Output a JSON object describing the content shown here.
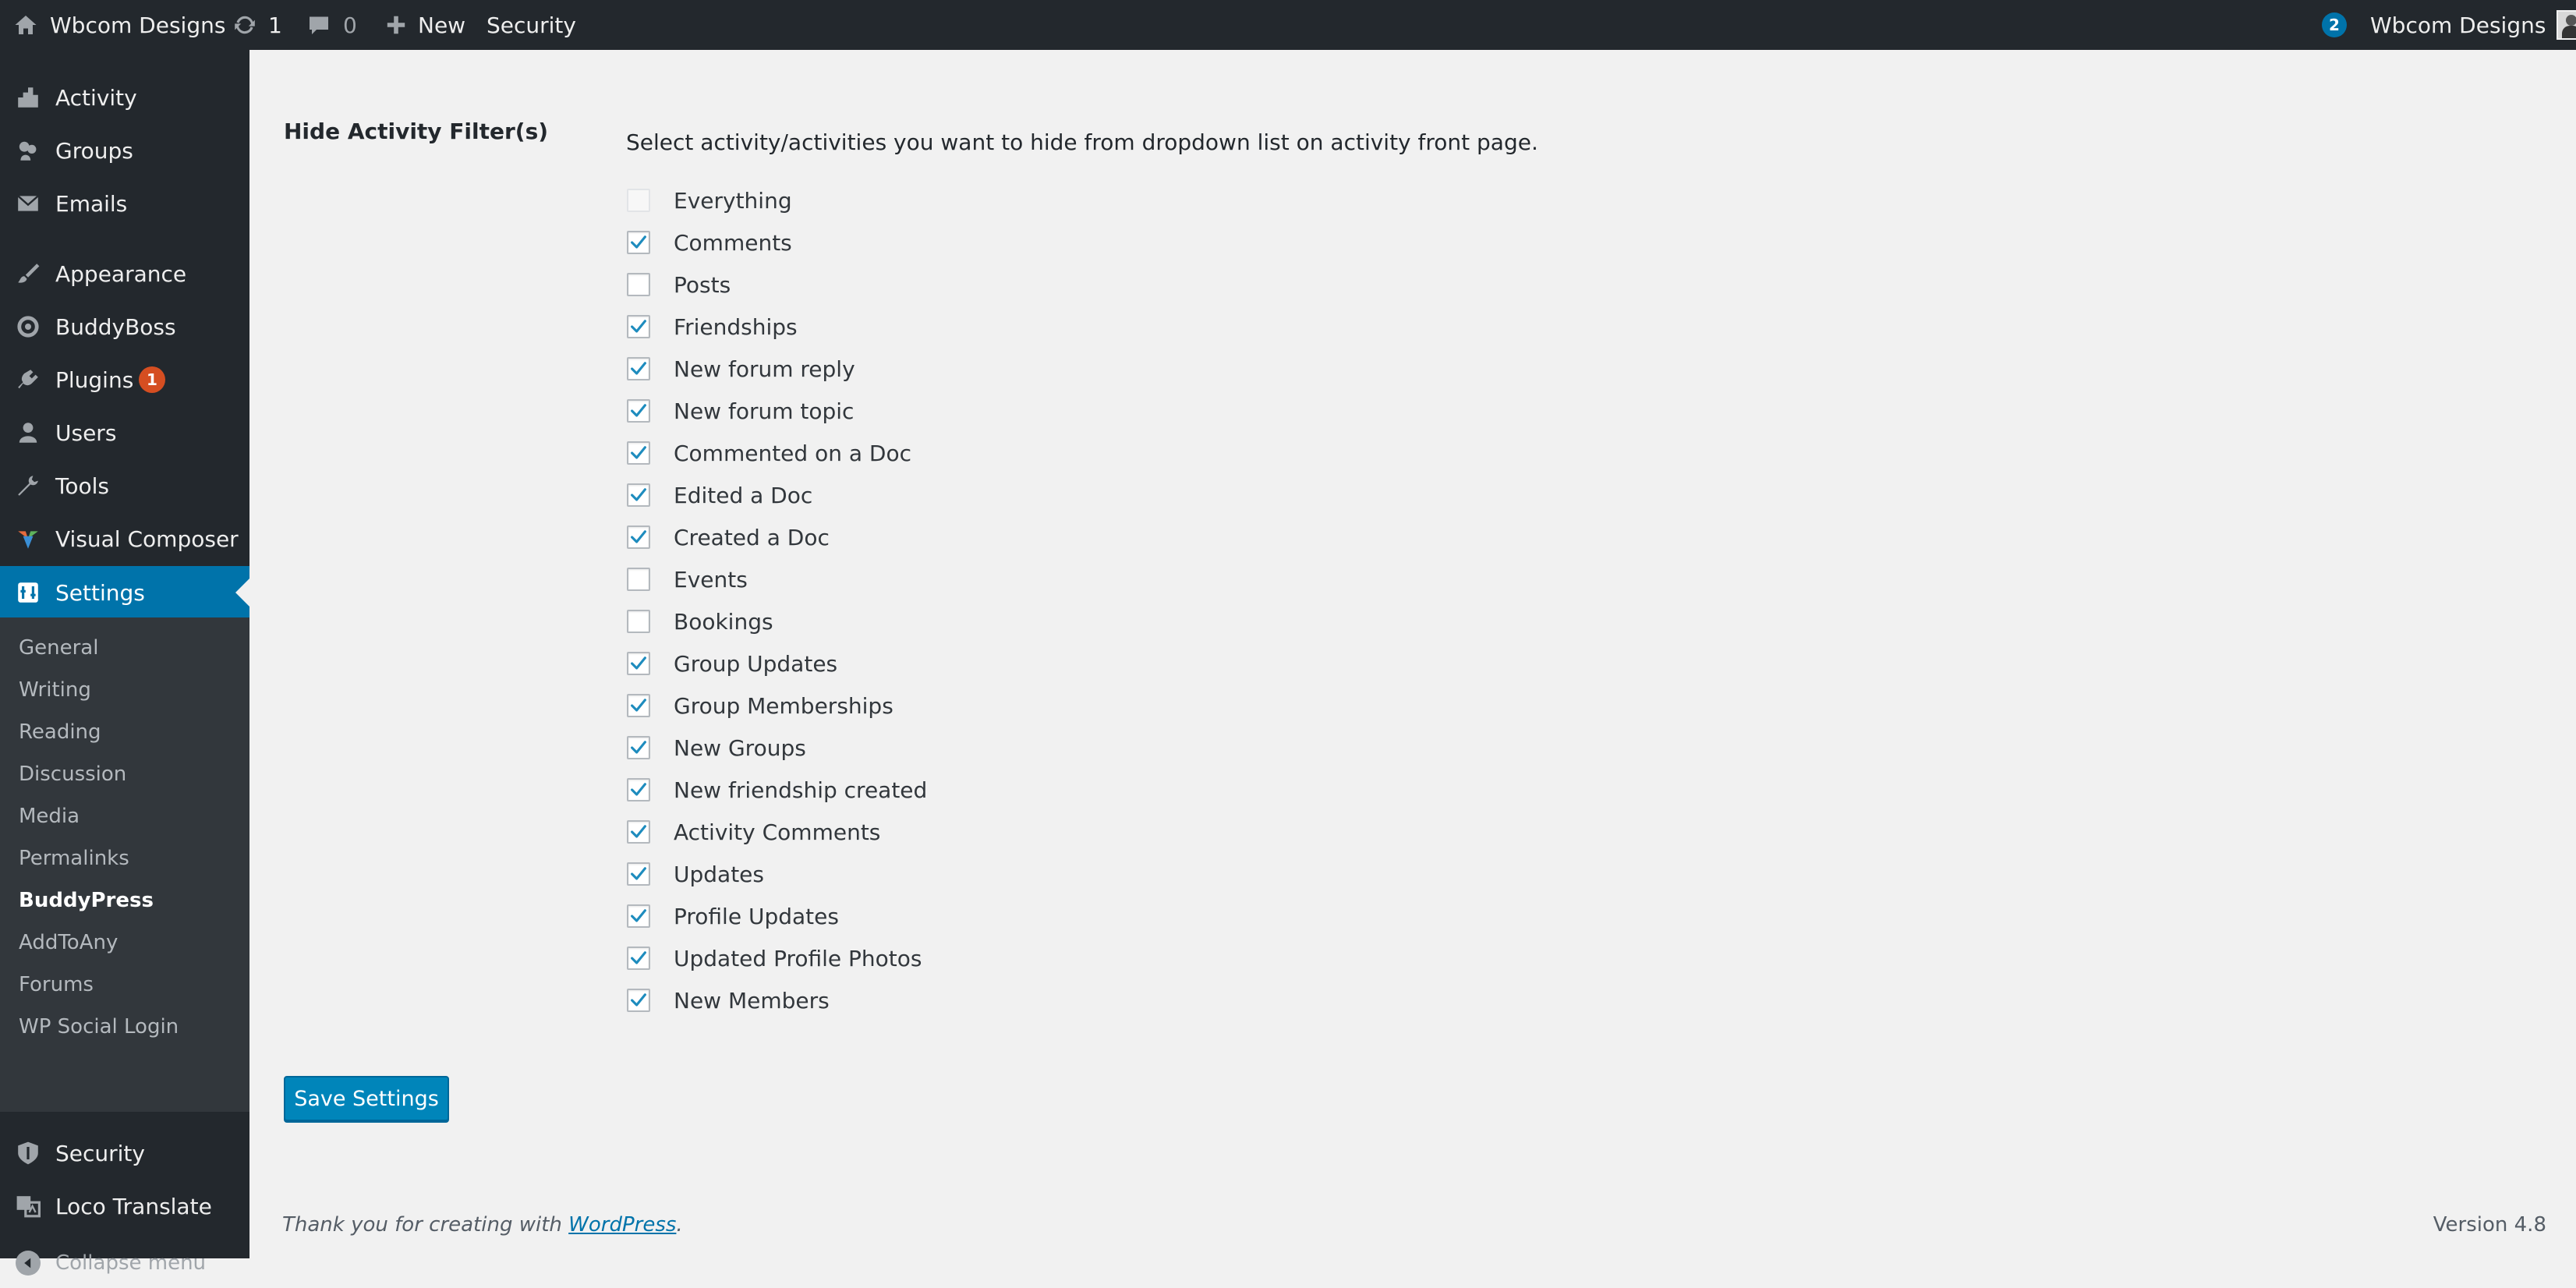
{
  "admin_bar": {
    "site_name": "Wbcom Designs",
    "updates_count": "1",
    "comments_count": "0",
    "new_label": "New",
    "security_label": "Security",
    "notifications_count": "2",
    "account_name": "Wbcom Designs"
  },
  "sidebar": {
    "items": [
      {
        "label": "Activity",
        "icon": "activity-icon"
      },
      {
        "label": "Groups",
        "icon": "groups-icon"
      },
      {
        "label": "Emails",
        "icon": "email-icon"
      },
      {
        "label": "Appearance",
        "icon": "paintbrush-icon"
      },
      {
        "label": "BuddyBoss",
        "icon": "buddyboss-icon"
      },
      {
        "label": "Plugins",
        "icon": "plugin-icon",
        "badge": "1"
      },
      {
        "label": "Users",
        "icon": "users-icon"
      },
      {
        "label": "Tools",
        "icon": "wrench-icon"
      },
      {
        "label": "Visual Composer",
        "icon": "visual-composer-icon"
      },
      {
        "label": "Settings",
        "icon": "settings-icon",
        "current": true
      }
    ],
    "submenu": [
      "General",
      "Writing",
      "Reading",
      "Discussion",
      "Media",
      "Permalinks",
      "BuddyPress",
      "AddToAny",
      "Forums",
      "WP Social Login"
    ],
    "submenu_current": "BuddyPress",
    "bottom_items": [
      {
        "label": "Security",
        "icon": "shield-icon"
      },
      {
        "label": "Loco Translate",
        "icon": "translate-icon"
      }
    ],
    "collapse_label": "Collapse menu"
  },
  "main": {
    "section_title": "Hide Activity Filter(s)",
    "description": "Select activity/activities you want to hide from dropdown list on activity front page.",
    "filters": [
      {
        "label": "Everything",
        "checked": false,
        "disabled": true
      },
      {
        "label": "Comments",
        "checked": true
      },
      {
        "label": "Posts",
        "checked": false
      },
      {
        "label": "Friendships",
        "checked": true
      },
      {
        "label": "New forum reply",
        "checked": true
      },
      {
        "label": "New forum topic",
        "checked": true
      },
      {
        "label": "Commented on a Doc",
        "checked": true
      },
      {
        "label": "Edited a Doc",
        "checked": true
      },
      {
        "label": "Created a Doc",
        "checked": true
      },
      {
        "label": "Events",
        "checked": false
      },
      {
        "label": "Bookings",
        "checked": false
      },
      {
        "label": "Group Updates",
        "checked": true
      },
      {
        "label": "Group Memberships",
        "checked": true
      },
      {
        "label": "New Groups",
        "checked": true
      },
      {
        "label": "New friendship created",
        "checked": true
      },
      {
        "label": "Activity Comments",
        "checked": true
      },
      {
        "label": "Updates",
        "checked": true
      },
      {
        "label": "Profile Updates",
        "checked": true
      },
      {
        "label": "Updated Profile Photos",
        "checked": true
      },
      {
        "label": "New Members",
        "checked": true
      }
    ],
    "save_label": "Save Settings"
  },
  "footer": {
    "thanks_prefix": "Thank you for creating with ",
    "thanks_link": "WordPress",
    "thanks_suffix": ".",
    "version": "Version 4.8"
  },
  "colors": {
    "admin_bar": "#23282d",
    "sidebar": "#23282d",
    "submenu": "#32373c",
    "accent": "#0073aa",
    "button": "#0085ba",
    "badge": "#d54e21",
    "check": "#1e8cbe"
  }
}
